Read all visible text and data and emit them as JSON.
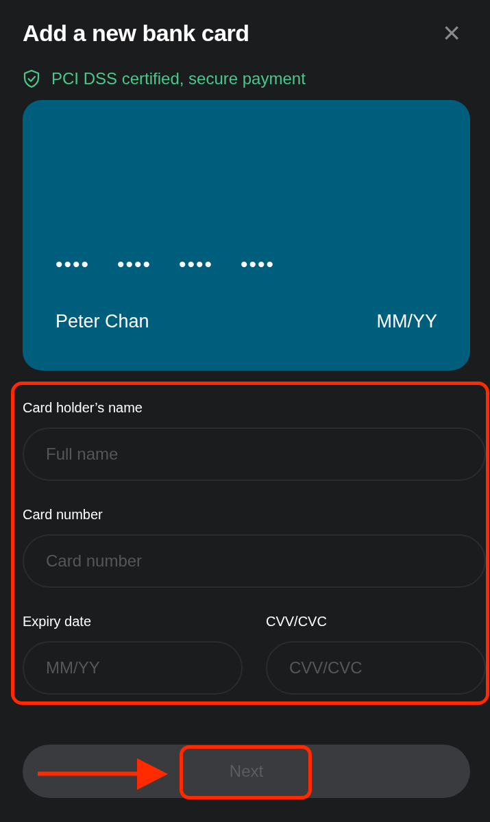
{
  "dialog": {
    "title": "Add a new bank card",
    "close_label": "×"
  },
  "security_note": "PCI DSS certified, secure payment",
  "card_preview": {
    "number_groups": [
      "••••",
      "••••",
      "••••",
      "••••"
    ],
    "holder": "Peter Chan",
    "expiry": "MM/YY"
  },
  "form": {
    "fields": [
      {
        "label": "Card holder’s name",
        "placeholder": "Full name",
        "kind": "full"
      },
      {
        "label": "Card number",
        "placeholder": "Card number",
        "kind": "full"
      },
      {
        "label": "Expiry date",
        "placeholder": "MM/YY",
        "kind": "half"
      },
      {
        "label": "CVV/CVC",
        "placeholder": "CVV/CVC",
        "kind": "half"
      }
    ]
  },
  "next_button": {
    "label": "Next",
    "disabled": true
  }
}
